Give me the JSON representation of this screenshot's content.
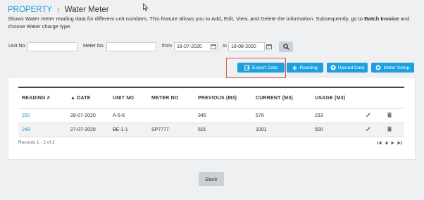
{
  "breadcrumb": {
    "root": "PROPERTY",
    "separator": "›",
    "page": "Water Meter"
  },
  "description": {
    "text_before": "Shows Water meter reading data for different unit numbers. This feature allows you to Add, Edit, View, and Delete the information. Subsequently, go to ",
    "bold": "Batch Invoice",
    "text_after": " and choose Water charge type."
  },
  "filters": {
    "unit_label": "Unit No.",
    "unit_value": "",
    "meter_label": "Meter No.",
    "meter_value": "",
    "from_label": "from",
    "from_value": "18-07-2020",
    "to_label": "to",
    "to_value": "18-08-2020",
    "search_icon": "search-icon",
    "calendar_icon": "calendar-icon"
  },
  "toolbar": {
    "export_label": "Export Data",
    "reading_label": "Reading",
    "upload_label": "Upload Data",
    "meter_setup_label": "Meter Setup"
  },
  "table": {
    "columns": [
      "READING #",
      "▲ DATE",
      "UNIT NO",
      "METER NO",
      "PREVIOUS (M3)",
      "CURRENT (M3)",
      "USAGE (M3)"
    ],
    "rows": [
      {
        "reading": "250",
        "date": "28-07-2020",
        "unit": "A-5-6",
        "meter": "",
        "previous": "345",
        "current": "578",
        "usage": "233"
      },
      {
        "reading": "248",
        "date": "27-07-2020",
        "unit": "BE-1-1",
        "meter": "SP7777",
        "previous": "501",
        "current": "1001",
        "usage": "500"
      }
    ]
  },
  "records": "Records 1 - 2 of 2",
  "back_label": "Back",
  "colors": {
    "accent": "#1ea0de",
    "highlight": "#d9534f",
    "link": "#1e9bd7"
  }
}
